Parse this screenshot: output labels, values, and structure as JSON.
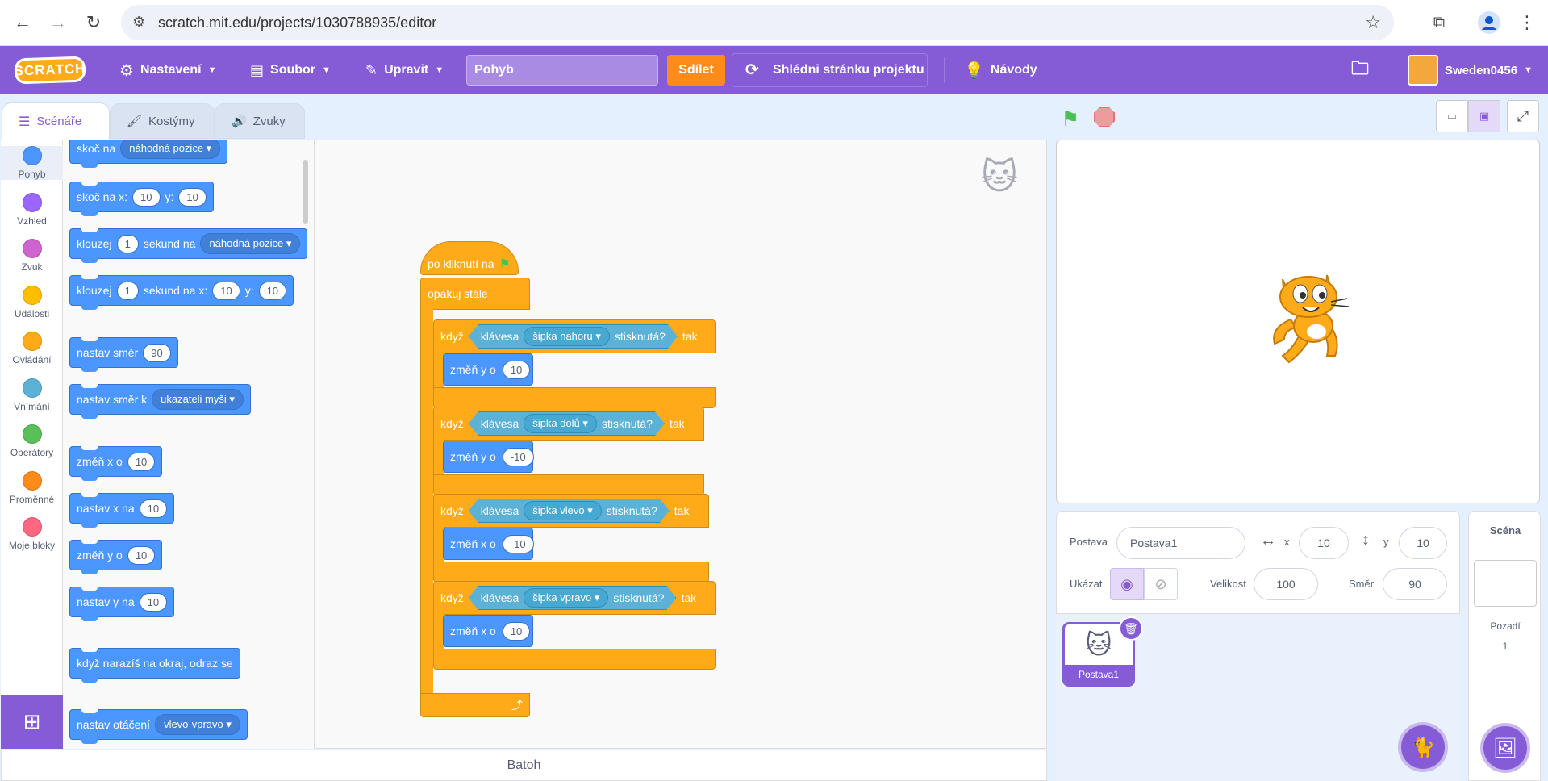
{
  "browser": {
    "url": "scratch.mit.edu/projects/1030788935/editor"
  },
  "menu": {
    "logo": "SCRATCH",
    "settings": "Nastavení",
    "file": "Soubor",
    "edit": "Upravit",
    "project_title": "Pohyb",
    "share": "Sdílet",
    "see_project_page": "Shlédni stránku projektu",
    "tutorials": "Návody",
    "username": "Sweden0456"
  },
  "tabs": {
    "code": "Scénáře",
    "costumes": "Kostýmy",
    "sounds": "Zvuky"
  },
  "categories": [
    {
      "label": "Pohyb",
      "color": "#4c97ff"
    },
    {
      "label": "Vzhled",
      "color": "#9966ff"
    },
    {
      "label": "Zvuk",
      "color": "#cf63cf"
    },
    {
      "label": "Události",
      "color": "#ffbf00"
    },
    {
      "label": "Ovládání",
      "color": "#ffab19"
    },
    {
      "label": "Vnímání",
      "color": "#5cb1d6"
    },
    {
      "label": "Operátory",
      "color": "#59c059"
    },
    {
      "label": "Proměnné",
      "color": "#ff8c1a"
    },
    {
      "label": "Moje bloky",
      "color": "#ff6680"
    }
  ],
  "palette": {
    "goto_label": "skoč na",
    "goto_target": "náhodná pozice",
    "gotoxy_label": "skoč na x:",
    "gotoxy_x": "10",
    "y_label": "y:",
    "gotoxy_y": "10",
    "glide_label": "klouzej",
    "glide_secs": "1",
    "glide_secs_to": "sekund na",
    "glide_target": "náhodná pozice",
    "glide2_secs_to": "sekund na x:",
    "glide2_secs": "1",
    "glide2_x": "10",
    "glide2_y": "10",
    "point_dir_label": "nastav směr",
    "point_dir_value": "90",
    "point_towards_label": "nastav směr k",
    "point_towards_target": "ukazateli myši",
    "change_x_label": "změň x o",
    "change_x_value": "10",
    "set_x_label": "nastav x na",
    "set_x_value": "10",
    "change_y_label": "změň y o",
    "change_y_value": "10",
    "set_y_label": "nastav y na",
    "set_y_value": "10",
    "bounce_label": "když narazíš na okraj, odraz se",
    "rotation_label": "nastav otáčení",
    "rotation_value": "vlevo-vpravo"
  },
  "script": {
    "hat": "po kliknutí na",
    "forever": "opakuj stále",
    "if_word": "když",
    "key_word": "klávesa",
    "pressed_word": "stisknutá?",
    "then_word": "tak",
    "ifs": [
      {
        "key": "šipka nahoru",
        "action": "změň y o",
        "value": "10"
      },
      {
        "key": "šipka dolů",
        "action": "změň y o",
        "value": "-10"
      },
      {
        "key": "šipka vlevo",
        "action": "změň x o",
        "value": "-10"
      },
      {
        "key": "šipka vpravo",
        "action": "změň x o",
        "value": "10"
      }
    ]
  },
  "backpack": "Batoh",
  "sprite_info": {
    "sprite_label": "Postava",
    "sprite_name": "Postava1",
    "x_label": "x",
    "x_value": "10",
    "y_label": "y",
    "y_value": "10",
    "show_label": "Ukázat",
    "size_label": "Velikost",
    "size_value": "100",
    "direction_label": "Směr",
    "direction_value": "90"
  },
  "sprites": [
    {
      "name": "Postava1"
    }
  ],
  "stage_panel": {
    "title": "Scéna",
    "backdrops_label": "Pozadí",
    "backdrops_count": "1"
  }
}
